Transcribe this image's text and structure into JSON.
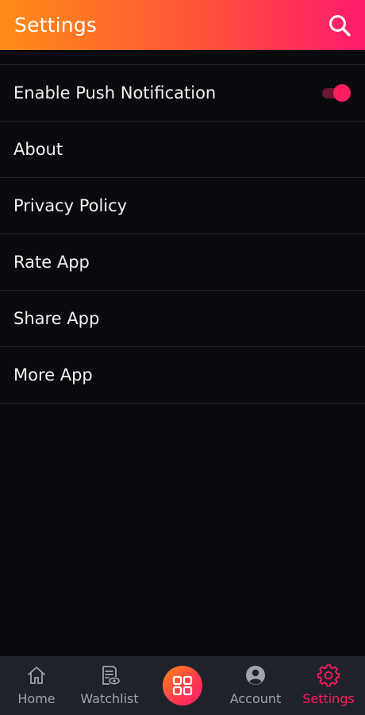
{
  "header": {
    "title": "Settings",
    "search_icon": "search-icon"
  },
  "settings": {
    "push_notification": {
      "label": "Enable Push Notification",
      "enabled": true
    },
    "about": {
      "label": "About"
    },
    "privacy_policy": {
      "label": "Privacy Policy"
    },
    "rate_app": {
      "label": "Rate App"
    },
    "share_app": {
      "label": "Share App"
    },
    "more_app": {
      "label": "More App"
    }
  },
  "bottom_nav": {
    "home": {
      "label": "Home",
      "icon": "home-icon"
    },
    "watchlist": {
      "label": "Watchlist",
      "icon": "watchlist-icon"
    },
    "center": {
      "icon": "grid-icon"
    },
    "account": {
      "label": "Account",
      "icon": "account-icon"
    },
    "settings": {
      "label": "Settings",
      "icon": "gear-icon",
      "active": true
    }
  },
  "colors": {
    "accent": "#ff1d5e",
    "header_gradient_start": "#ff8c17",
    "header_gradient_end": "#ff1a6d",
    "background": "#0a0b0e",
    "nav_background": "#20222b",
    "inactive_nav": "#9ea3ad"
  }
}
